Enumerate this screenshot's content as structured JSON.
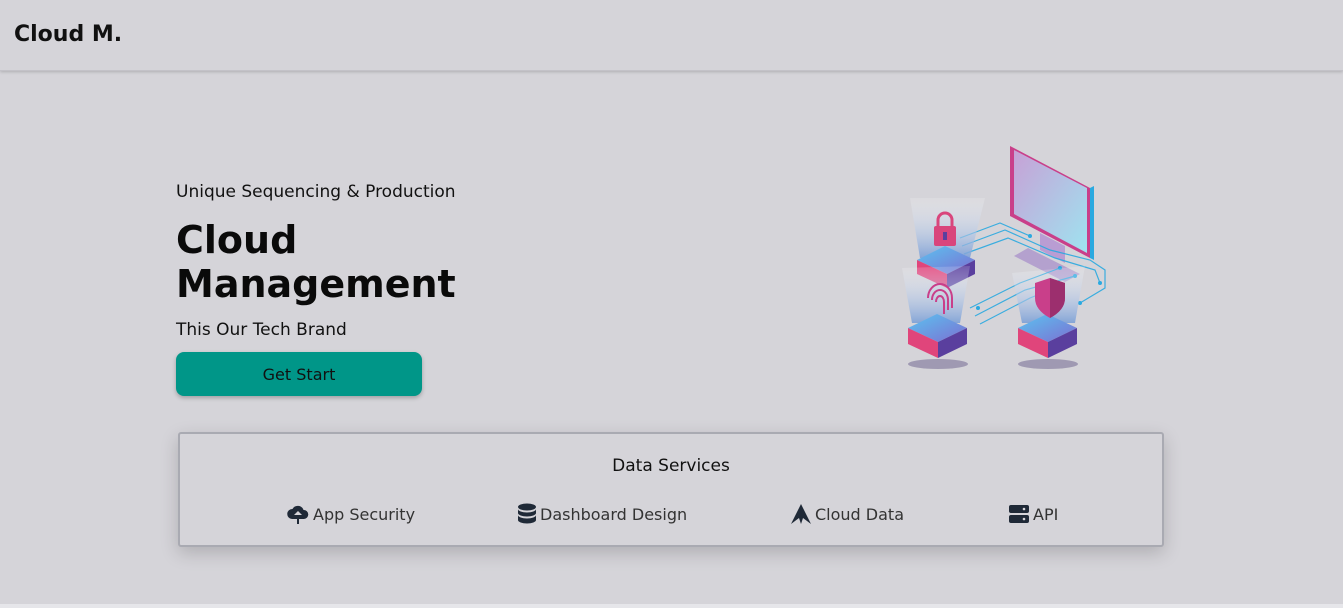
{
  "navbar": {
    "brand": "Cloud M."
  },
  "hero": {
    "eyebrow": "Unique Sequencing & Production",
    "headline": "Cloud Management",
    "tagline": "This Our Tech Brand",
    "cta_label": "Get Start",
    "cta_color": "#009688",
    "illustration_icons": [
      "lock-icon",
      "fingerprint-icon",
      "shield-icon",
      "monitor-icon"
    ]
  },
  "services": {
    "title": "Data Services",
    "items": [
      {
        "label": "App Security",
        "icon": "cloud-upload-icon"
      },
      {
        "label": "Dashboard Design",
        "icon": "database-icon"
      },
      {
        "label": "Cloud Data",
        "icon": "arrow-peak-icon"
      },
      {
        "label": "API",
        "icon": "server-icon"
      }
    ]
  },
  "colors": {
    "background": "#d5d4d9",
    "accent": "#009688",
    "icon": "#1f2937",
    "illustration_pink": "#e0457b",
    "illustration_blue": "#29a9e1"
  }
}
